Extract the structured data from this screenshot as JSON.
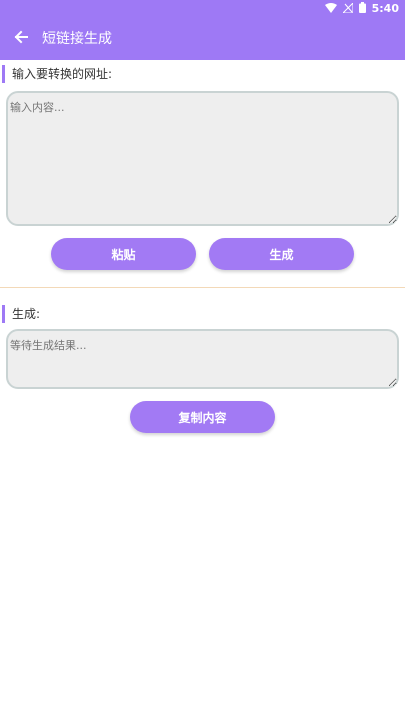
{
  "status_bar": {
    "time": "5:40",
    "icons": [
      "wifi-icon",
      "signal-icon",
      "battery-icon"
    ]
  },
  "header": {
    "title": "短链接生成",
    "back_icon": "arrow-left-icon"
  },
  "input_section": {
    "label": "输入要转换的网址:",
    "placeholder": "输入内容...",
    "value": ""
  },
  "actions": {
    "paste_label": "粘贴",
    "generate_label": "生成"
  },
  "result_section": {
    "label": "生成:",
    "placeholder": "等待生成结果...",
    "value": ""
  },
  "copy_label": "复制内容",
  "colors": {
    "accent": "#9e79f5",
    "button": "#a27af4",
    "field_bg": "#eeeeee",
    "field_border": "#c9d3d3",
    "divider": "#f3d9b8"
  }
}
